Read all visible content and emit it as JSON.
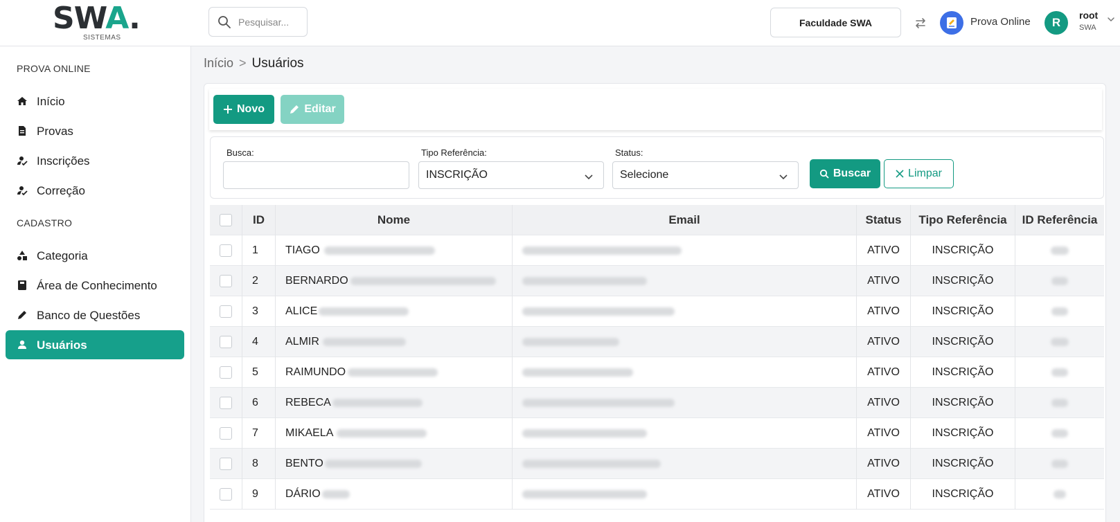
{
  "header": {
    "logo_text": "SWA.",
    "logo_sub": "SISTEMAS",
    "search_placeholder": "Pesquisar...",
    "institution": "Faculdade SWA",
    "app_name": "Prova Online",
    "avatar_initial": "R",
    "user_name": "root",
    "user_org": "SWA"
  },
  "sidebar": {
    "section1": "PROVA ONLINE",
    "section2": "CADASTRO",
    "items": [
      {
        "label": "Início",
        "icon": "home-icon"
      },
      {
        "label": "Provas",
        "icon": "document-icon"
      },
      {
        "label": "Inscrições",
        "icon": "user-check-icon"
      },
      {
        "label": "Correção",
        "icon": "user-check-icon"
      },
      {
        "label": "Categoria",
        "icon": "shapes-icon"
      },
      {
        "label": "Área de Conhecimento",
        "icon": "book-icon"
      },
      {
        "label": "Banco de Questões",
        "icon": "pencil-icon"
      },
      {
        "label": "Usuários",
        "icon": "user-icon",
        "active": true
      }
    ]
  },
  "breadcrumb": {
    "home": "Início",
    "separator": ">",
    "current": "Usuários"
  },
  "toolbar": {
    "new_label": "Novo",
    "edit_label": "Editar"
  },
  "filters": {
    "busca_label": "Busca:",
    "busca_value": "",
    "tipo_label": "Tipo Referência:",
    "tipo_value": "INSCRIÇÃO",
    "status_label": "Status:",
    "status_value": "Selecione",
    "search_button": "Buscar",
    "clear_button": "Limpar"
  },
  "table": {
    "columns": [
      "ID",
      "Nome",
      "Email",
      "Status",
      "Tipo Referência",
      "ID Referência"
    ],
    "rows": [
      {
        "id": "1",
        "first_name": "TIAGO",
        "status": "ATIVO",
        "tipo": "INSCRIÇÃO"
      },
      {
        "id": "2",
        "first_name": "BERNARDO",
        "status": "ATIVO",
        "tipo": "INSCRIÇÃO"
      },
      {
        "id": "3",
        "first_name": "ALICE",
        "status": "ATIVO",
        "tipo": "INSCRIÇÃO"
      },
      {
        "id": "4",
        "first_name": "ALMIR",
        "status": "ATIVO",
        "tipo": "INSCRIÇÃO"
      },
      {
        "id": "5",
        "first_name": "RAIMUNDO",
        "status": "ATIVO",
        "tipo": "INSCRIÇÃO"
      },
      {
        "id": "6",
        "first_name": "REBECA",
        "status": "ATIVO",
        "tipo": "INSCRIÇÃO"
      },
      {
        "id": "7",
        "first_name": "MIKAELA",
        "status": "ATIVO",
        "tipo": "INSCRIÇÃO"
      },
      {
        "id": "8",
        "first_name": "BENTO",
        "status": "ATIVO",
        "tipo": "INSCRIÇÃO"
      },
      {
        "id": "9",
        "first_name": "DÁRIO",
        "status": "ATIVO",
        "tipo": "INSCRIÇÃO"
      }
    ]
  },
  "colors": {
    "accent": "#139a82",
    "accent_light": "#84d3c3",
    "brand_blue": "#3d6fe6"
  }
}
